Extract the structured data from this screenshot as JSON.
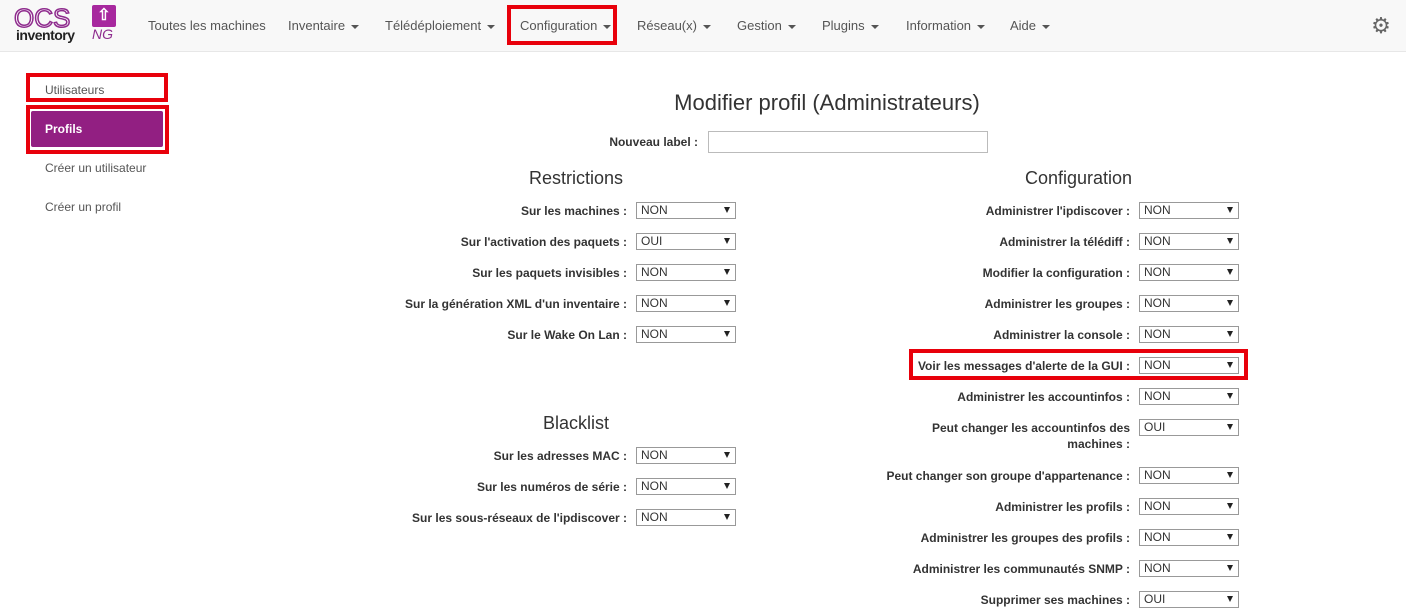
{
  "logo": {
    "ocs": "OCS",
    "inventory": "inventory",
    "ng": "NG",
    "arrow_icon": "up-arrow-icon"
  },
  "nav": {
    "items": [
      "Toutes les machines",
      "Inventaire",
      "Télédéploiement",
      "Configuration",
      "Réseau(x)",
      "Gestion",
      "Plugins",
      "Information",
      "Aide"
    ],
    "settings_icon": "gear-icon"
  },
  "sidebar": {
    "items": [
      "Utilisateurs",
      "Profils",
      "Créer un utilisateur",
      "Créer un profil"
    ]
  },
  "main": {
    "title": "Modifier profil (Administrateurs)",
    "new_label": "Nouveau label :",
    "new_label_value": "",
    "restrictions": {
      "title": "Restrictions",
      "rows": [
        {
          "label": "Sur les machines :",
          "value": "NON"
        },
        {
          "label": "Sur l'activation des paquets :",
          "value": "OUI"
        },
        {
          "label": "Sur les paquets invisibles :",
          "value": "NON"
        },
        {
          "label": "Sur la génération XML d'un inventaire :",
          "value": "NON"
        },
        {
          "label": "Sur le Wake On Lan :",
          "value": "NON"
        }
      ]
    },
    "blacklist": {
      "title": "Blacklist",
      "rows": [
        {
          "label": "Sur les adresses MAC :",
          "value": "NON"
        },
        {
          "label": "Sur les numéros de série :",
          "value": "NON"
        },
        {
          "label": "Sur les sous-réseaux de l'ipdiscover :",
          "value": "NON"
        }
      ]
    },
    "configuration": {
      "title": "Configuration",
      "rows": [
        {
          "label": "Administrer l'ipdiscover :",
          "value": "NON"
        },
        {
          "label": "Administrer la télédiff :",
          "value": "NON"
        },
        {
          "label": "Modifier la configuration :",
          "value": "NON"
        },
        {
          "label": "Administrer les groupes :",
          "value": "NON"
        },
        {
          "label": "Administrer la console :",
          "value": "NON"
        },
        {
          "label": "Voir les messages d'alerte de la GUI :",
          "value": "NON"
        },
        {
          "label": "Administrer les accountinfos :",
          "value": "NON"
        },
        {
          "label": "Peut changer les accountinfos des",
          "label2": "machines :",
          "value": "OUI"
        },
        {
          "label": "Peut changer son groupe d'appartenance :",
          "value": "NON"
        },
        {
          "label": "Administrer les profils :",
          "value": "NON"
        },
        {
          "label": "Administrer les groupes des profils :",
          "value": "NON"
        },
        {
          "label": "Administrer les communautés SNMP :",
          "value": "NON"
        },
        {
          "label": "Supprimer ses machines :",
          "value": "OUI"
        }
      ]
    }
  }
}
